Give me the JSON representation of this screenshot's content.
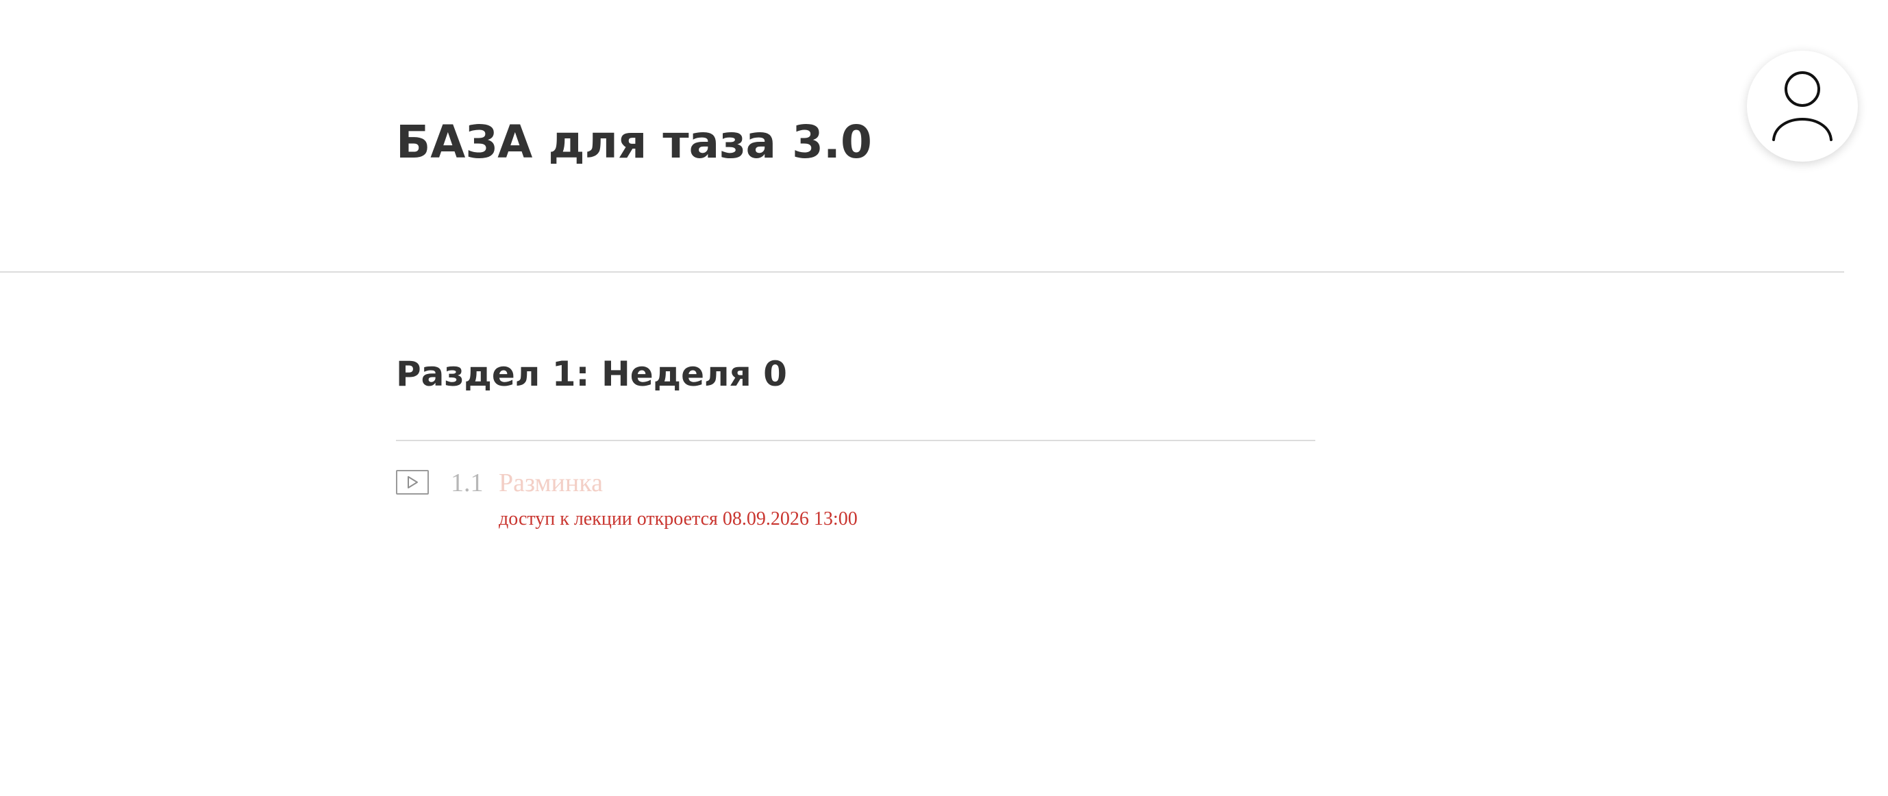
{
  "course": {
    "title": "БАЗА для таза 3.0"
  },
  "user_menu": {
    "icon": "user-icon"
  },
  "sections": [
    {
      "title": "Раздел 1: Неделя 0",
      "lessons": [
        {
          "icon": "play-icon",
          "number": "1.1",
          "name": "Разминка",
          "access_note": "доступ к лекции откроется 08.09.2026 13:00"
        }
      ]
    }
  ],
  "colors": {
    "heading": "#333333",
    "divider": "#dcdcdc",
    "lesson_number": "#b7b7b7",
    "lesson_name_locked": "#f3cfc6",
    "access_note": "#c9352f"
  }
}
